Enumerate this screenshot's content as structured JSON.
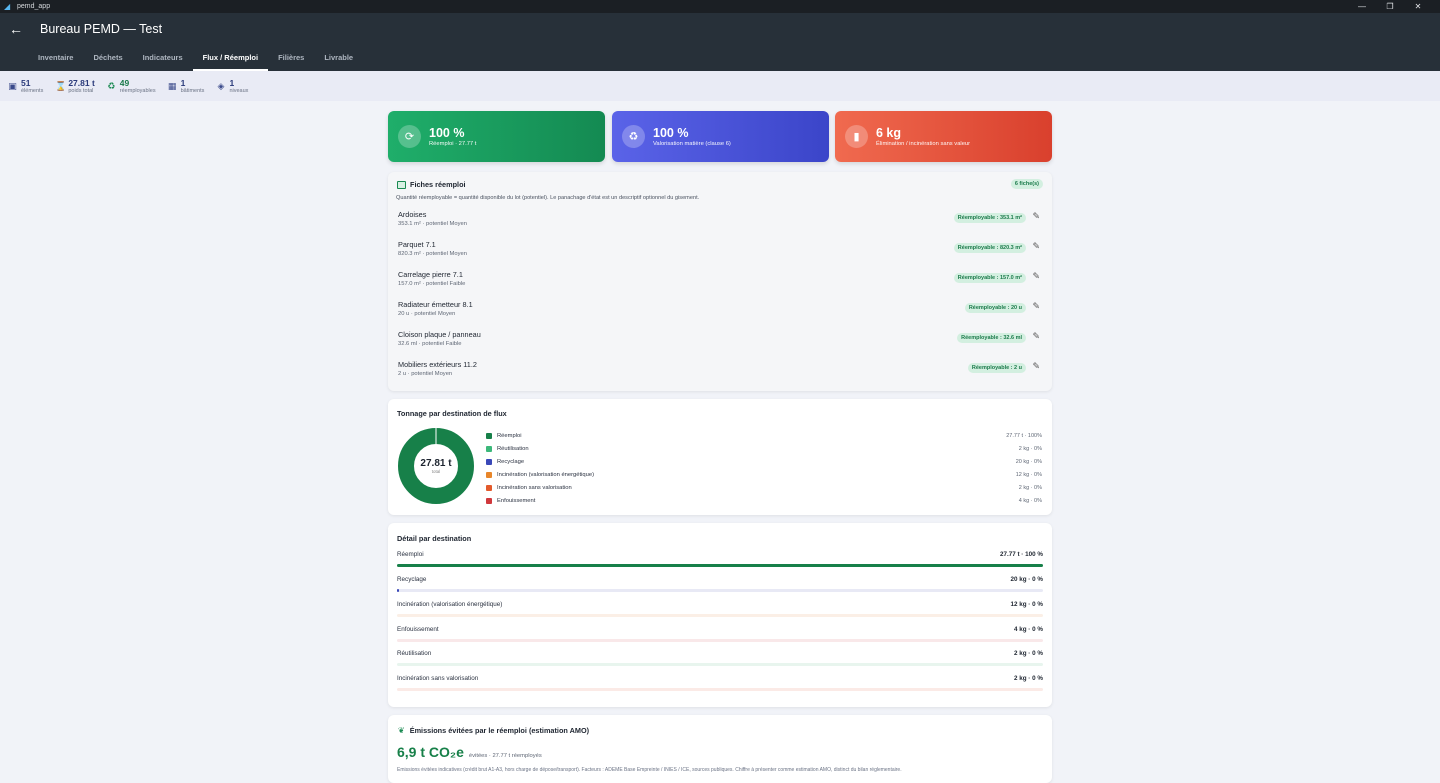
{
  "window": {
    "app_title": "pemd_app",
    "minimize": "—",
    "maximize": "❐",
    "close": "✕"
  },
  "appbar": {
    "title": "Bureau PEMD — Test",
    "back_icon": "arrow-left-icon"
  },
  "tabs": [
    {
      "label": "Inventaire",
      "active": false
    },
    {
      "label": "Déchets",
      "active": false
    },
    {
      "label": "Indicateurs",
      "active": false
    },
    {
      "label": "Flux / Réemploi",
      "active": true
    },
    {
      "label": "Filières",
      "active": false
    },
    {
      "label": "Livrable",
      "active": false
    }
  ],
  "stats": [
    {
      "icon": "box-icon",
      "value": "51",
      "label": "éléments"
    },
    {
      "icon": "scale-icon",
      "value": "27.81 t",
      "label": "poids total"
    },
    {
      "icon": "recycle-icon",
      "value": "49",
      "label": "réemployables"
    },
    {
      "icon": "building-icon",
      "value": "1",
      "label": "bâtiments"
    },
    {
      "icon": "layers-icon",
      "value": "1",
      "label": "niveaux"
    }
  ],
  "summary": [
    {
      "value": "100 %",
      "label": "Réemploi · 27.77 t",
      "icon": "sync-icon",
      "color": "#1fae6a"
    },
    {
      "value": "100 %",
      "label": "Valorisation matière (clause 6)",
      "icon": "recycle-icon",
      "color": "#4a53d9"
    },
    {
      "value": "6 kg",
      "label": "Élimination / incinération sans valeur",
      "icon": "trash-icon",
      "color": "#e5533b"
    }
  ],
  "fiches": {
    "title": "Fiches réemploi",
    "count": "6 fiche(s)",
    "description": "Quantité réemployable = quantité disponible du lot (potentiel). Le panachage d'état est un descriptif optionnel du gisement.",
    "items": [
      {
        "name": "Ardoises",
        "sub": "353.1 m² · potentiel Moyen",
        "badge": "Réemployable : 353.1 m²"
      },
      {
        "name": "Parquet 7.1",
        "sub": "820.3 m² · potentiel Moyen",
        "badge": "Réemployable : 820.3 m²"
      },
      {
        "name": "Carrelage pierre 7.1",
        "sub": "157.0 m² · potentiel Faible",
        "badge": "Réemployable : 157.0 m²"
      },
      {
        "name": "Radiateur émetteur 8.1",
        "sub": "20 u · potentiel Moyen",
        "badge": "Réemployable : 20 u"
      },
      {
        "name": "Cloison plaque / panneau",
        "sub": "32.6 ml · potentiel Faible",
        "badge": "Réemployable : 32.6 ml"
      },
      {
        "name": "Mobiliers extérieurs 11.2",
        "sub": "2 u · potentiel Moyen",
        "badge": "Réemployable : 2 u"
      }
    ]
  },
  "tonnage": {
    "title": "Tonnage par destination de flux",
    "total_value": "27.81 t",
    "total_label": "total",
    "legend": [
      {
        "name": "Réemploi",
        "value": "27.77 t · 100%",
        "color": "#178049",
        "share": 99.86
      },
      {
        "name": "Réutilisation",
        "value": "2 kg · 0%",
        "color": "#3cb87a",
        "share": 0.01
      },
      {
        "name": "Recyclage",
        "value": "20 kg · 0%",
        "color": "#3a48b8",
        "share": 0.07
      },
      {
        "name": "Incinération (valorisation énergétique)",
        "value": "12 kg · 0%",
        "color": "#e8862a",
        "share": 0.04
      },
      {
        "name": "Incinération sans valorisation",
        "value": "2 kg · 0%",
        "color": "#e35a2c",
        "share": 0.01
      },
      {
        "name": "Enfouissement",
        "value": "4 kg · 0%",
        "color": "#d0383c",
        "share": 0.01
      }
    ]
  },
  "detail": {
    "title": "Détail par destination",
    "rows": [
      {
        "name": "Réemploi",
        "value": "27.77 t · 100 %",
        "pct": 100,
        "color": "#178049",
        "track": "#e5ecf0"
      },
      {
        "name": "Recyclage",
        "value": "20 kg · 0 %",
        "pct": 0.1,
        "color": "#3a48b8",
        "track": "#e8e9f5"
      },
      {
        "name": "Incinération (valorisation énergétique)",
        "value": "12 kg · 0 %",
        "pct": 0,
        "color": "#e8862a",
        "track": "#fbefe6"
      },
      {
        "name": "Enfouissement",
        "value": "4 kg · 0 %",
        "pct": 0,
        "color": "#d0383c",
        "track": "#f9e8e9"
      },
      {
        "name": "Réutilisation",
        "value": "2 kg · 0 %",
        "pct": 0,
        "color": "#3cb87a",
        "track": "#e8f5ee"
      },
      {
        "name": "Incinération sans valorisation",
        "value": "2 kg · 0 %",
        "pct": 0,
        "color": "#e35a2c",
        "track": "#fbeae6"
      }
    ]
  },
  "emissions": {
    "title": "Émissions évitées par le réemploi (estimation AMO)",
    "value": "6,9 t CO₂e",
    "sub": "évitées · 27.77 t réemployés",
    "note": "Émissions évitées indicatives (crédit brut A1-A3, hors charge de dépose/transport). Facteurs : ADEME Base Empreinte / INIES / ICE, sources publiques. Chiffre à présenter comme estimation AMO, distinct du bilan réglementaire."
  }
}
